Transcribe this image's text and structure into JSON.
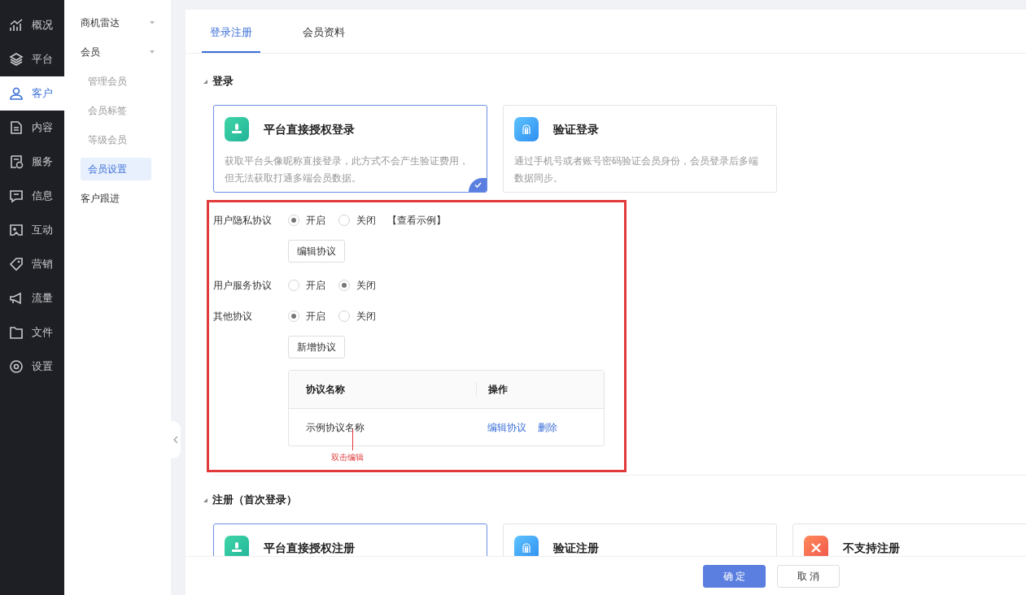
{
  "nav": [
    {
      "label": "概况",
      "selected": false
    },
    {
      "label": "平台",
      "selected": false
    },
    {
      "label": "客户",
      "selected": true
    },
    {
      "label": "内容",
      "selected": false
    },
    {
      "label": "服务",
      "selected": false
    },
    {
      "label": "信息",
      "selected": false
    },
    {
      "label": "互动",
      "selected": false
    },
    {
      "label": "营销",
      "selected": false
    },
    {
      "label": "流量",
      "selected": false
    },
    {
      "label": "文件",
      "selected": false
    },
    {
      "label": "设置",
      "selected": false
    }
  ],
  "subnav": [
    {
      "label": "商机雷达",
      "kind": "group"
    },
    {
      "label": "会员",
      "kind": "group",
      "children": [
        {
          "label": "管理会员",
          "selected": false
        },
        {
          "label": "会员标签",
          "selected": false
        },
        {
          "label": "等级会员",
          "selected": false
        },
        {
          "label": "会员设置",
          "selected": true
        }
      ]
    },
    {
      "label": "客户跟进",
      "kind": "link"
    }
  ],
  "tabs": [
    {
      "label": "登录注册",
      "selected": true
    },
    {
      "label": "会员资料",
      "selected": false
    }
  ],
  "login": {
    "title": "登录",
    "options": [
      {
        "title": "平台直接授权登录",
        "description": "获取平台头像昵称直接登录，此方式不会产生验证费用，但无法获取打通多端会员数据。",
        "selected": true
      },
      {
        "title": "验证登录",
        "description": "通过手机号或者账号密码验证会员身份，会员登录后多端数据同步。",
        "selected": false
      }
    ]
  },
  "agreements": [
    {
      "label": "用户隐私协议",
      "options": [
        {
          "label": "开启",
          "selected": true
        },
        {
          "label": "关闭",
          "selected": false
        }
      ],
      "link": "【查看示例】",
      "button": "编辑协议"
    },
    {
      "label": "用户服务协议",
      "options": [
        {
          "label": "开启",
          "selected": false
        },
        {
          "label": "关闭",
          "selected": true
        }
      ]
    },
    {
      "label": "其他协议",
      "options": [
        {
          "label": "开启",
          "selected": true
        },
        {
          "label": "关闭",
          "selected": false
        }
      ],
      "button": "新增协议"
    }
  ],
  "agreement_table": {
    "columns": [
      "协议名称",
      "操作"
    ],
    "rows": [
      {
        "name": "示例协议名称",
        "actions": [
          "编辑协议",
          "删除"
        ]
      }
    ],
    "annotation": "双击编辑"
  },
  "register": {
    "title": "注册（首次登录）",
    "options": [
      {
        "title": "平台直接授权注册",
        "selected": true
      },
      {
        "title": "验证注册",
        "selected": false
      },
      {
        "title": "不支持注册",
        "selected": false
      }
    ]
  },
  "footer_buttons": [
    {
      "label": "确 定",
      "kind": "primary"
    },
    {
      "label": "取 消",
      "kind": "default"
    }
  ]
}
